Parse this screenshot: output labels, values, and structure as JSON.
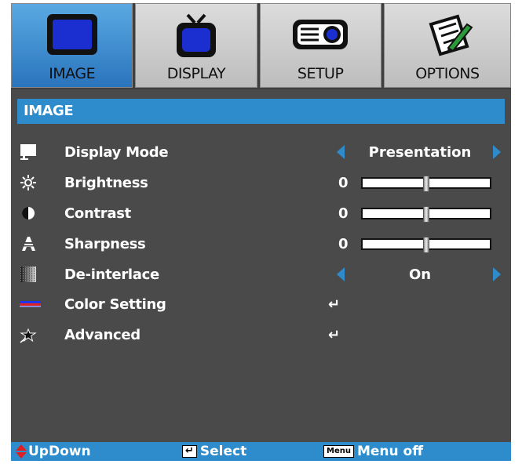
{
  "tabs": [
    {
      "label": "IMAGE",
      "icon": "monitor-icon",
      "active": true
    },
    {
      "label": "DISPLAY",
      "icon": "tv-icon",
      "active": false
    },
    {
      "label": "SETUP",
      "icon": "projector-icon",
      "active": false
    },
    {
      "label": "OPTIONS",
      "icon": "notepad-pencil-icon",
      "active": false
    }
  ],
  "section_title": "IMAGE",
  "items": [
    {
      "label": "Display Mode",
      "icon": "monitor-icon",
      "value": "Presentation"
    },
    {
      "label": "Brightness",
      "icon": "sun-icon",
      "value": "0",
      "level": 0.5
    },
    {
      "label": "Contrast",
      "icon": "contrast-icon",
      "value": "0",
      "level": 0.5
    },
    {
      "label": "Sharpness",
      "icon": "sharpness-icon",
      "value": "0",
      "level": 0.5
    },
    {
      "label": "De-interlace",
      "icon": "deinterlace-icon",
      "value": "On"
    },
    {
      "label": "Color Setting",
      "icon": "color-bars-icon",
      "value": "↵"
    },
    {
      "label": "Advanced",
      "icon": "star-icon",
      "value": "↵"
    }
  ],
  "footer": {
    "updown": "UpDown",
    "select": "Select",
    "menu_key": "Menu",
    "menu_off": "Menu off"
  },
  "colors": {
    "accent": "#2e8ccc",
    "background": "#4a4a4a"
  }
}
